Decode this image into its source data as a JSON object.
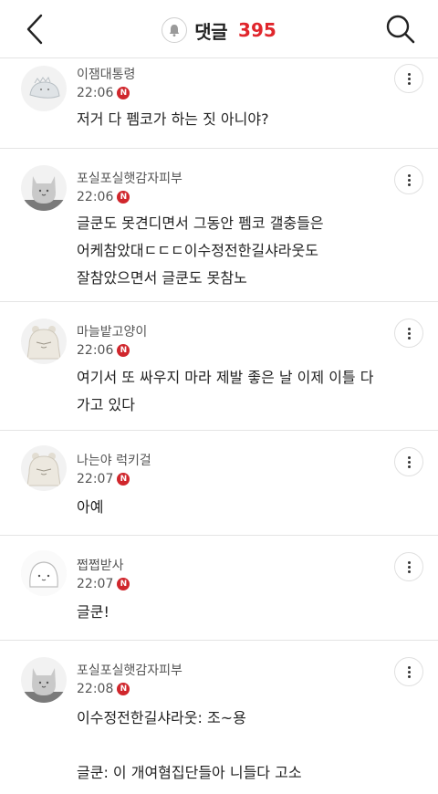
{
  "header": {
    "title": "댓글",
    "count": "395",
    "back_icon": "chevron-left-icon",
    "notification_icon": "bell-icon",
    "search_icon": "search-icon"
  },
  "comments": [
    {
      "nickname": "이잼대통령",
      "time": "22:06",
      "badge": "N",
      "lines": [
        "저거 다 펨코가 하는 짓 아니야?"
      ]
    },
    {
      "nickname": "포실포실햇감자피부",
      "time": "22:06",
      "badge": "N",
      "lines": [
        "글쿤도 못견디면서 그동안 펨코 갤충들은",
        "어케참았대ㄷㄷㄷ이수정전한길샤라웃도",
        "잘참았으면서 글쿤도 못참노"
      ]
    },
    {
      "nickname": "마늘밭고양이",
      "time": "22:06",
      "badge": "N",
      "lines": [
        "여기서 또 싸우지 마라 제발 좋은 날 이제 이틀 다",
        "가고 있다"
      ]
    },
    {
      "nickname": "나는야 럭키걸",
      "time": "22:07",
      "badge": "N",
      "lines": [
        "아예"
      ]
    },
    {
      "nickname": "쩝쩝받사",
      "time": "22:07",
      "badge": "N",
      "lines": [
        "글쿤!"
      ]
    },
    {
      "nickname": "포실포실햇감자피부",
      "time": "22:08",
      "badge": "N",
      "lines": [
        "이수정전한길샤라웃: 조~용",
        "",
        "글쿤: 이 개여혐집단들아 니들다 고소"
      ]
    }
  ]
}
